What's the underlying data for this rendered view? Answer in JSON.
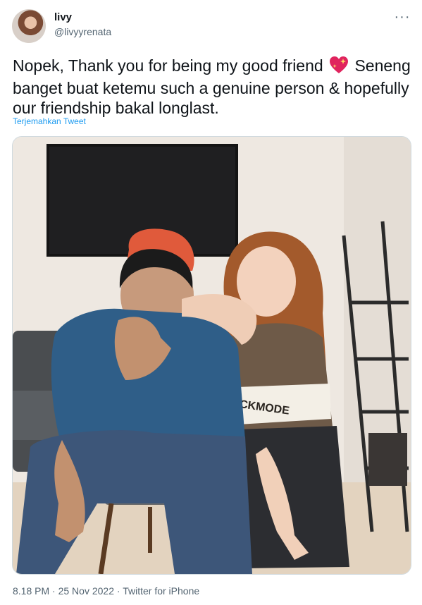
{
  "author": {
    "display_name": "livy",
    "handle": "@livyyrenata"
  },
  "more_label": "···",
  "tweet": {
    "text_before_emoji": "Nopek, Thank you for being my good friend ",
    "emoji": "sparkling-heart",
    "text_after_emoji": " Seneng banget buat ketemu such a genuine person & hopefully our friendship bakal longlast.",
    "translate_label": "Terjemahkan Tweet"
  },
  "media": {
    "shirt_text": "CKMODE"
  },
  "meta": {
    "time": "8.18 PM",
    "separator": " · ",
    "date": "25 Nov 2022",
    "source": "Twitter for iPhone"
  }
}
